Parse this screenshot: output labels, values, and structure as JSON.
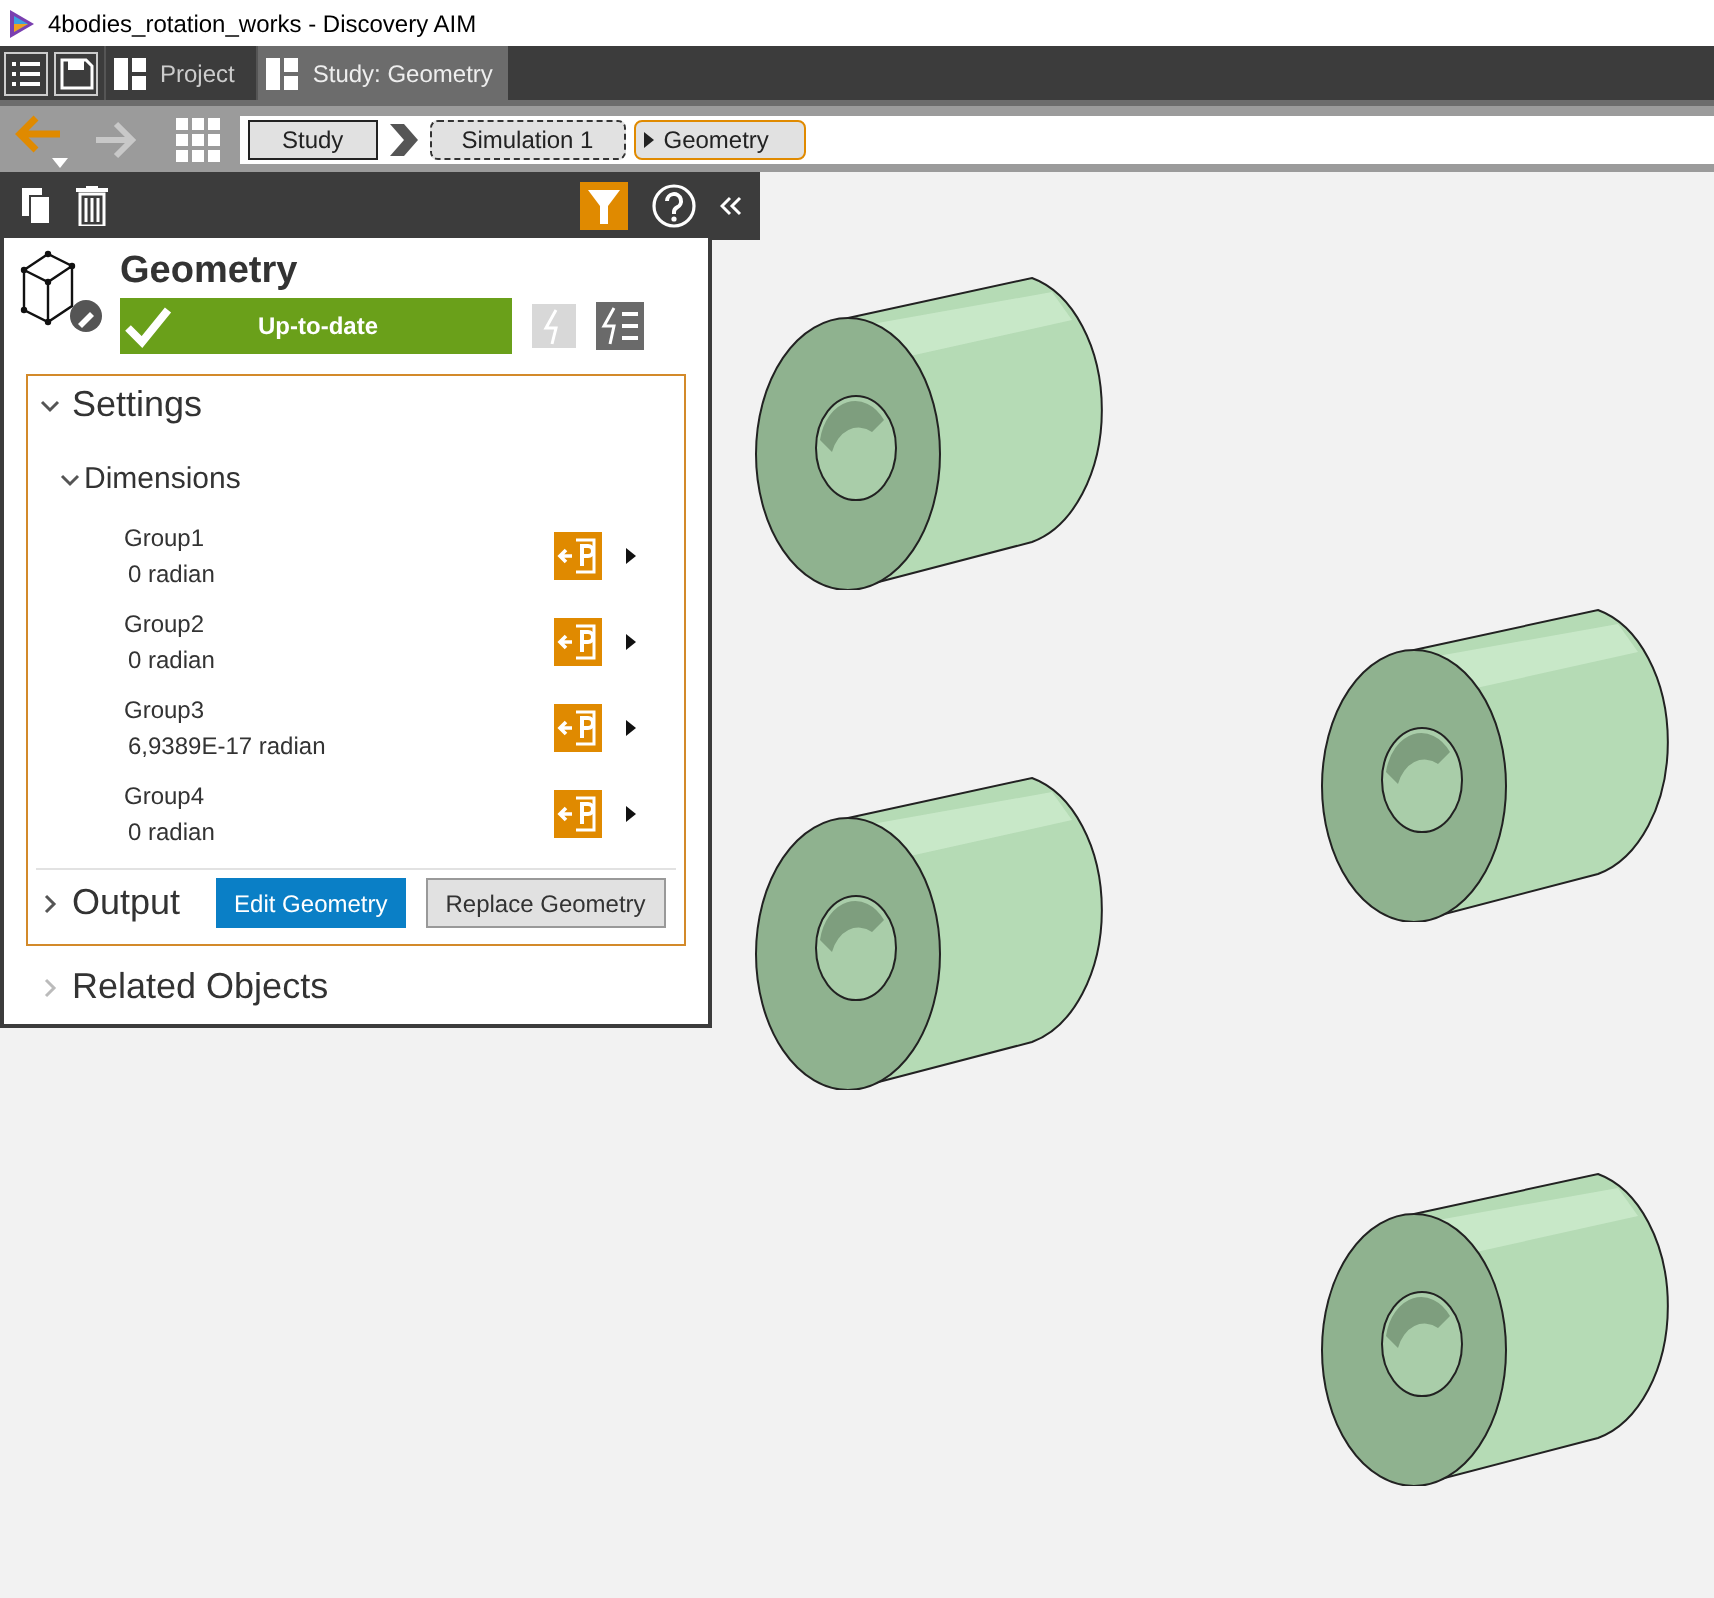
{
  "window": {
    "title": "4bodies_rotation_works - Discovery AIM"
  },
  "tabs": [
    {
      "label": "Project",
      "selected": false
    },
    {
      "label": "Study: Geometry",
      "selected": true
    }
  ],
  "breadcrumb": [
    {
      "label": "Study",
      "kind": "solid"
    },
    {
      "label": "Simulation 1",
      "kind": "dashed"
    },
    {
      "label": "Geometry",
      "kind": "current"
    }
  ],
  "panel": {
    "title": "Geometry",
    "status": "Up-to-date",
    "settings": {
      "label": "Settings",
      "expanded": true,
      "dimensions": {
        "label": "Dimensions",
        "expanded": true,
        "items": [
          {
            "name": "Group1",
            "value": "0 radian"
          },
          {
            "name": "Group2",
            "value": "0 radian"
          },
          {
            "name": "Group3",
            "value": "6,9389E-17 radian"
          },
          {
            "name": "Group4",
            "value": "0 radian"
          }
        ]
      }
    },
    "output": {
      "label": "Output",
      "expanded": false,
      "buttons": [
        {
          "label": "Edit Geometry",
          "kind": "primary"
        },
        {
          "label": "Replace Geometry",
          "kind": "secondary"
        }
      ]
    },
    "related": {
      "label": "Related Objects",
      "expanded": false
    }
  }
}
